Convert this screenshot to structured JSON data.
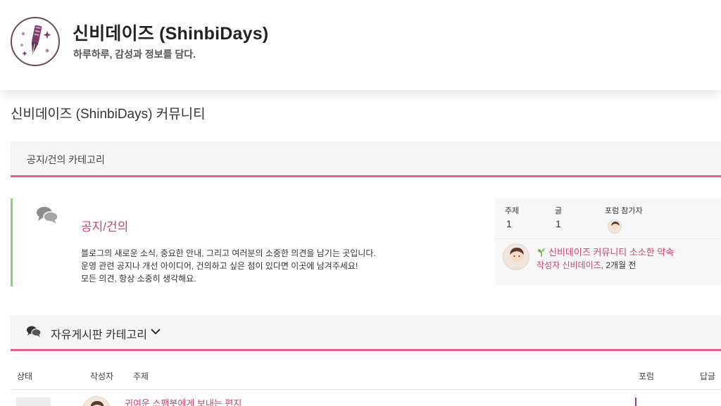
{
  "site": {
    "title": "신비데이즈 (ShinbiDays)",
    "tagline": "하루하루, 감성과 정보를 담다."
  },
  "page": {
    "title": "신비데이즈 (ShinbiDays) 커뮤니티"
  },
  "categories": [
    {
      "label": "공지/건의 카테고리"
    },
    {
      "label": "자유게시판 카테고리"
    }
  ],
  "forum": {
    "name": "공지/건의",
    "description": [
      "블로그의 새로운 소식, 중요한 안내, 그리고 여러분의 소중한 의견을 남기는 곳입니다.",
      "운영 관련 공지나 개선 아이디어, 건의하고 싶은 점이 있다면 이곳에 남겨주세요!",
      "모든 의견, 항상 소중히 생각해요."
    ],
    "stats": {
      "topics_label": "주제",
      "topics_value": "1",
      "posts_label": "글",
      "posts_value": "1",
      "participants_label": "포럼 참가자"
    },
    "last_post": {
      "topic": "신비데이즈 커뮤니티 소소한 약속",
      "author_prefix": "작성자 신비데이즈",
      "time": ", 2개월 전"
    }
  },
  "table_headers": {
    "status": "상태",
    "author": "작성자",
    "topic": "주제",
    "forum": "포럼",
    "replies": "답글"
  },
  "topics": [
    {
      "title": "귀여운 스팸봇에게 보내는 편지"
    }
  ],
  "colors": {
    "accent": "#e0608f",
    "link": "#c9466e",
    "forum_bar": "#8bd17a",
    "logo_ring": "#6a4a5e"
  },
  "icons": {
    "logo": "fountain-pen-logo",
    "forum": "chat-bubbles-icon",
    "category": "chat-bubbles-icon",
    "toggle": "chevron-down-icon",
    "sprout": "sprout-icon"
  }
}
